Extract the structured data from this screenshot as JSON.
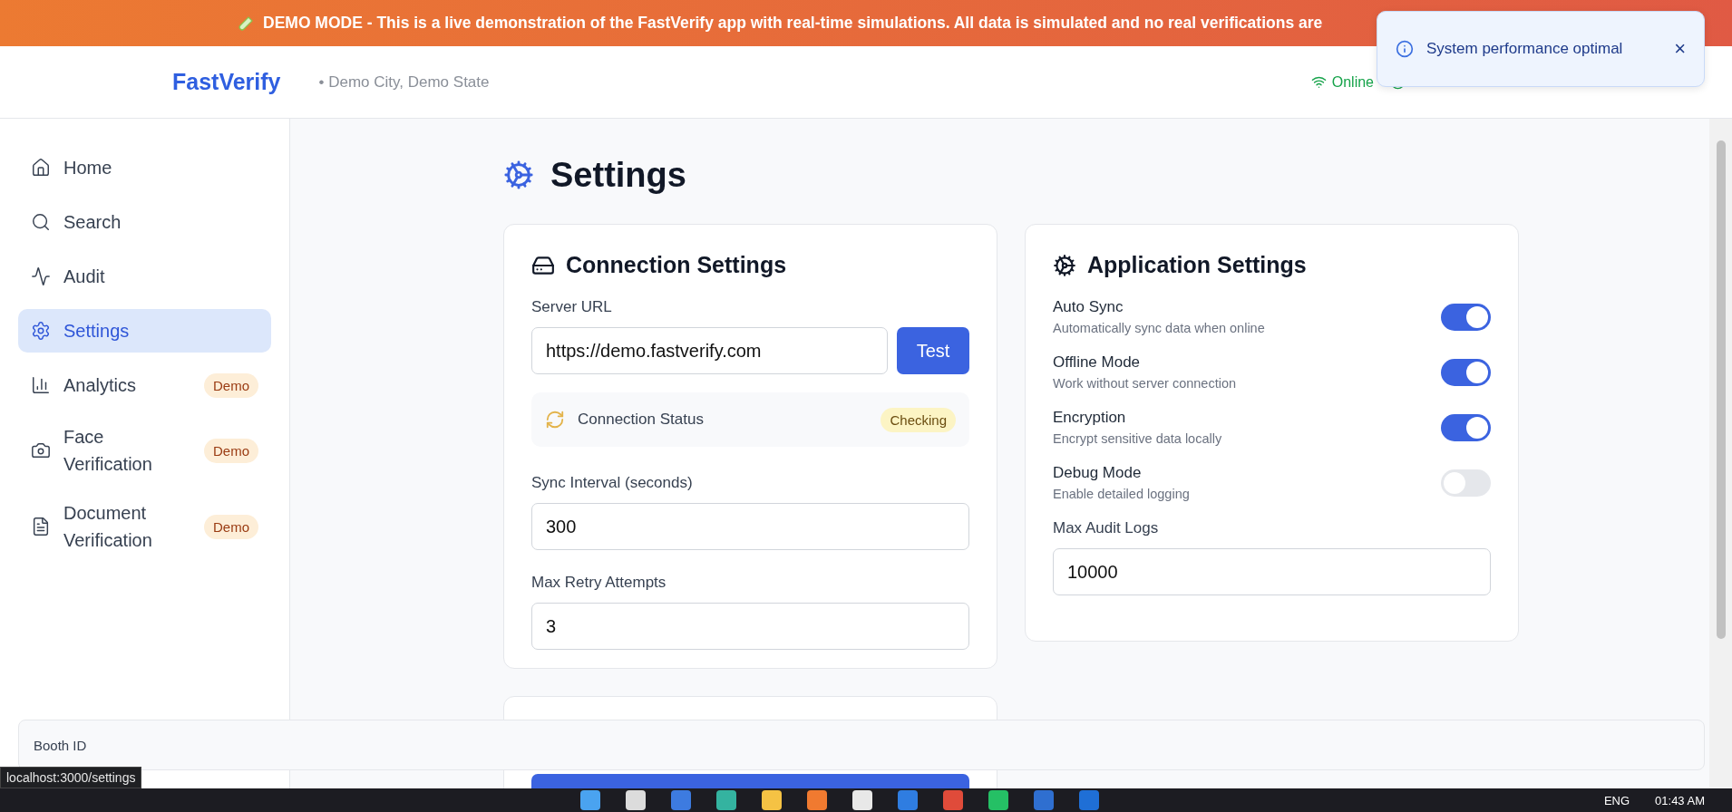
{
  "banner": {
    "title": "DEMO MODE -",
    "text": "This is a live demonstration of the FastVerify app with real-time simulations. All data is simulated and no real verifications are"
  },
  "header": {
    "brand": "FastVerify",
    "location": "• Demo City, Demo State",
    "online": "Online"
  },
  "toast": {
    "message": "System performance optimal",
    "close": "×"
  },
  "sidebar": {
    "items": [
      {
        "label": "Home",
        "selected": false
      },
      {
        "label": "Search",
        "selected": false
      },
      {
        "label": "Audit",
        "selected": false
      },
      {
        "label": "Settings",
        "selected": true
      },
      {
        "label": "Analytics",
        "selected": false,
        "badge": "Demo"
      },
      {
        "label": "Face Verification",
        "selected": false,
        "badge": "Demo"
      },
      {
        "label": "Document Verification",
        "selected": false,
        "badge": "Demo"
      }
    ]
  },
  "page": {
    "title": "Settings"
  },
  "connection": {
    "title": "Connection Settings",
    "server_label": "Server URL",
    "server_value": "https://demo.fastverify.com",
    "test_button": "Test",
    "status_label": "Connection Status",
    "status_badge": "Checking",
    "fields": [
      {
        "label": "Sync Interval (seconds)",
        "value": "300"
      },
      {
        "label": "Max Retry Attempts",
        "value": "3"
      }
    ]
  },
  "application": {
    "title": "Application Settings",
    "toggles": [
      {
        "label": "Auto Sync",
        "description": "Automatically sync data when online",
        "on": true
      },
      {
        "label": "Offline Mode",
        "description": "Work without server connection",
        "on": true
      },
      {
        "label": "Encryption",
        "description": "Encrypt sensitive data locally",
        "on": true
      },
      {
        "label": "Debug Mode",
        "description": "Enable detailed logging",
        "on": false
      }
    ],
    "logs_label": "Max Audit Logs",
    "logs_value": "10000"
  },
  "booth": {
    "label": "Booth ID"
  },
  "status_url": "localhost:3000/settings",
  "taskbar": {
    "language": "ENG",
    "time": "01:43 AM"
  }
}
